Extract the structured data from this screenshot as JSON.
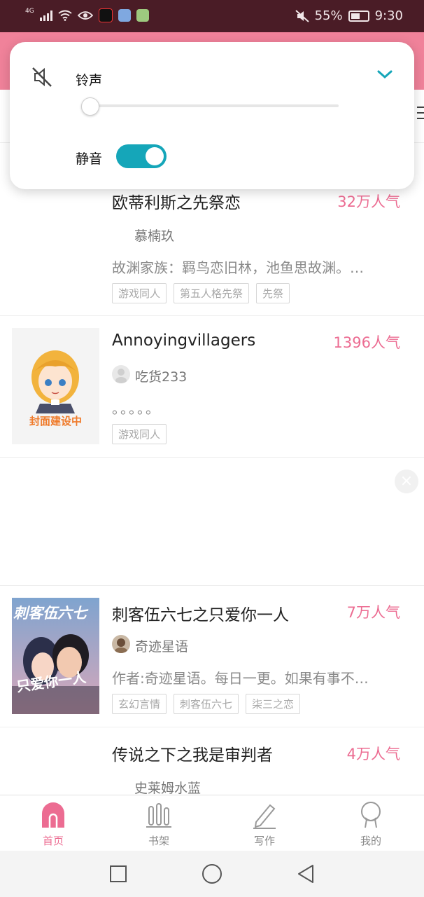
{
  "status_bar": {
    "network": "4G",
    "battery_percent": "55%",
    "time": "9:30"
  },
  "volume_panel": {
    "label": "铃声",
    "mute_label": "静音",
    "slider_level": 0,
    "mute_on": true
  },
  "items": [
    {
      "title": "欧蒂利斯之先祭恋",
      "popularity": "32万人气",
      "author": "慕楠玖",
      "description": "故渊家族：羁鸟恋旧林，池鱼思故渊。…",
      "tags": [
        "游戏同人",
        "第五人格先祭",
        "先祭"
      ]
    },
    {
      "title": "Annoyingvillagers",
      "popularity": "1396人气",
      "author": "吃货233",
      "description": "。。。。。",
      "tags": [
        "游戏同人"
      ],
      "cover_text": "封面建设中"
    },
    {
      "title": "刺客伍六七之只爱你一人",
      "popularity": "7万人气",
      "author": "奇迹星语",
      "description": "作者:奇迹星语。每日一更。如果有事不…",
      "tags": [
        "玄幻言情",
        "刺客伍六七",
        "柒三之恋"
      ],
      "cover_text_top": "刺客伍六七",
      "cover_text_bottom": "只爱你一人"
    },
    {
      "title": "传说之下之我是审判者",
      "popularity": "4万人气",
      "author": "史莱姆水蓝"
    }
  ],
  "tab_bar": {
    "home": "首页",
    "bookshelf": "书架",
    "write": "写作",
    "mine": "我的"
  },
  "colors": {
    "accent_pink": "#ec6c92",
    "toggle_teal": "#15a6b9",
    "status_bar_bg": "#4a1c26"
  }
}
